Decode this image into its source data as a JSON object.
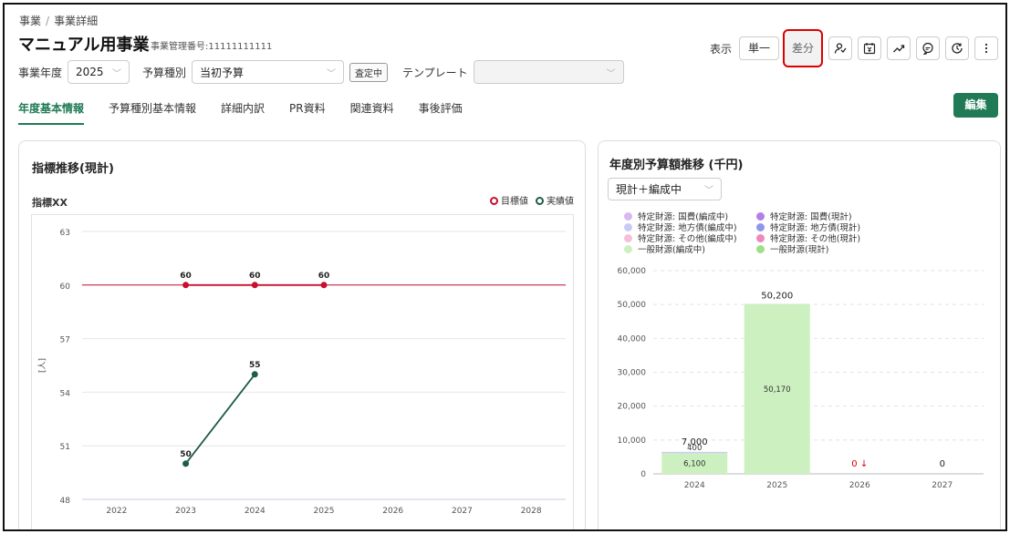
{
  "breadcrumb": {
    "root": "事業",
    "separator": "/",
    "current": "事業詳細"
  },
  "header": {
    "title": "マニュアル用事業",
    "mgmt_number": "事業管理番号:11111111111"
  },
  "view_toggle": {
    "label": "表示",
    "single": "単一",
    "diff": "差分"
  },
  "filters": {
    "year_label": "事業年度",
    "year_value": "2025",
    "budget_type_label": "予算種別",
    "budget_type_value": "当初予算",
    "status_badge": "査定中",
    "template_label": "テンプレート",
    "template_value": ""
  },
  "tabs": [
    "年度基本情報",
    "予算種別基本情報",
    "詳細内訳",
    "PR資料",
    "関連資料",
    "事後評価"
  ],
  "edit_label": "編集",
  "left_panel": {
    "title": "指標推移(現計)",
    "indicator": "指標XX",
    "legend_target": "目標値",
    "legend_actual": "実績値"
  },
  "right_panel": {
    "title": "年度別予算額推移 (千円)",
    "mode": "現計＋編成中",
    "legend": [
      {
        "label": "特定財源: 国費(編成中)",
        "color": "#d9b8f0"
      },
      {
        "label": "特定財源: 国費(現計)",
        "color": "#b47ee8"
      },
      {
        "label": "特定財源: 地方債(編成中)",
        "color": "#c8ccf4"
      },
      {
        "label": "特定財源: 地方債(現計)",
        "color": "#8f96ec"
      },
      {
        "label": "特定財源: その他(編成中)",
        "color": "#f6bfd9"
      },
      {
        "label": "特定財源: その他(現計)",
        "color": "#ef88bd"
      },
      {
        "label": "一般財源(編成中)",
        "color": "#cdf0c0"
      },
      {
        "label": "一般財源(現計)",
        "color": "#9fdf87"
      }
    ]
  },
  "colors": {
    "accent": "#1f7a55",
    "target": "#c8102e",
    "actual": "#1d5c45",
    "highlight": "#dd0000"
  },
  "chart_data": [
    {
      "type": "line",
      "ylabel": "[人]",
      "ylim": [
        48,
        63
      ],
      "yticks": [
        48,
        51,
        54,
        57,
        60,
        63
      ],
      "categories": [
        "2022",
        "2023",
        "2024",
        "2025",
        "2026",
        "2027",
        "2028"
      ],
      "series": [
        {
          "name": "目標値",
          "x": [
            "2023",
            "2024",
            "2025"
          ],
          "values": [
            60,
            60,
            60
          ],
          "color": "#c8102e"
        },
        {
          "name": "実績値",
          "x": [
            "2023",
            "2024"
          ],
          "values": [
            50,
            55
          ],
          "color": "#1d5c45"
        }
      ],
      "reference_line": 60,
      "grid": true
    },
    {
      "type": "bar",
      "stacked": true,
      "categories": [
        "2024",
        "2025",
        "2026",
        "2027"
      ],
      "ylim": [
        0,
        60000
      ],
      "yticks": [
        0,
        10000,
        20000,
        30000,
        40000,
        50000,
        60000
      ],
      "ytick_labels": [
        "0",
        "10,000",
        "20,000",
        "30,000",
        "40,000",
        "50,000",
        "60,000"
      ],
      "series": [
        {
          "name": "一般財源(編成中)",
          "values": [
            6100,
            50170,
            0,
            0
          ],
          "color": "#cdf0c0"
        },
        {
          "name": "特定財源: 地方債(編成中)",
          "values": [
            400,
            30,
            0,
            0
          ],
          "color": "#c8ccf4"
        }
      ],
      "segment_labels": [
        {
          "category": "2024",
          "series": "一般財源(編成中)",
          "text": "6,100"
        },
        {
          "category": "2024",
          "series": "特定財源: 地方債(編成中)",
          "text": "400"
        },
        {
          "category": "2025",
          "series": "一般財源(編成中)",
          "text": "50,170"
        }
      ],
      "totals": [
        {
          "category": "2024",
          "value": 7000,
          "text": "7,000"
        },
        {
          "category": "2025",
          "value": 50200,
          "text": "50,200"
        },
        {
          "category": "2026",
          "value": 0,
          "text": "0 ↓",
          "highlight": true
        },
        {
          "category": "2027",
          "value": 0,
          "text": "0"
        }
      ],
      "grid": true
    }
  ]
}
